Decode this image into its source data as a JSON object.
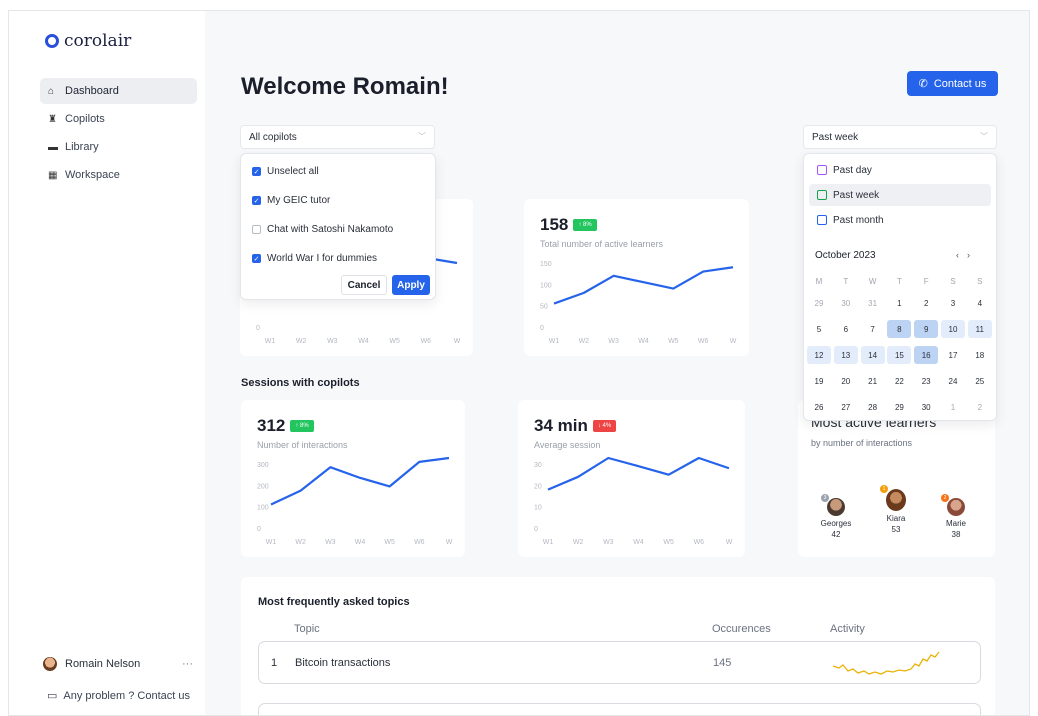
{
  "brand": {
    "name": "corolair",
    "accent": "#2563eb"
  },
  "sidebar": {
    "items": [
      {
        "label": "Dashboard",
        "icon": "home-icon",
        "active": true
      },
      {
        "label": "Copilots",
        "icon": "copilot-icon",
        "active": false
      },
      {
        "label": "Library",
        "icon": "folder-icon",
        "active": false
      },
      {
        "label": "Workspace",
        "icon": "building-icon",
        "active": false
      }
    ],
    "user": {
      "name": "Romain Nelson",
      "more": "···"
    },
    "help": "Any problem ? Contact us"
  },
  "header": {
    "title": "Welcome Romain!",
    "contact_label": "Contact us"
  },
  "filters": {
    "copilots_label": "All copilots",
    "period_label": "Past week"
  },
  "copilot_dropdown": {
    "options": [
      {
        "label": "Unselect all",
        "checked": true
      },
      {
        "label": "My GEIC tutor",
        "checked": true
      },
      {
        "label": "Chat with Satoshi Nakamoto",
        "checked": false
      },
      {
        "label": "World War I for dummies",
        "checked": true
      }
    ],
    "cancel": "Cancel",
    "apply": "Apply"
  },
  "period_dropdown": {
    "options": [
      {
        "label": "Past day",
        "color": "#a855f7",
        "selected": false
      },
      {
        "label": "Past week",
        "color": "#16a34a",
        "selected": true
      },
      {
        "label": "Past month",
        "color": "#2563eb",
        "selected": false
      }
    ],
    "month": "October 2023",
    "prev": "‹",
    "next": "›",
    "weekdays": [
      "M",
      "T",
      "W",
      "T",
      "F",
      "S",
      "S"
    ],
    "weeks": [
      [
        "29",
        "30",
        "31",
        "1",
        "2",
        "3",
        "4"
      ],
      [
        "5",
        "6",
        "7",
        "8",
        "9",
        "10",
        "11"
      ],
      [
        "12",
        "13",
        "14",
        "15",
        "16",
        "17",
        "18"
      ],
      [
        "19",
        "20",
        "21",
        "22",
        "23",
        "24",
        "25"
      ],
      [
        "26",
        "27",
        "28",
        "29",
        "30",
        "1",
        "2"
      ]
    ]
  },
  "sections": {
    "sessions": "Sessions with copilots"
  },
  "cards": {
    "learners": {
      "value": "158",
      "badge": "↑ 8%",
      "label": "Total number of active learners"
    },
    "interactions": {
      "value": "312",
      "badge": "↑ 8%",
      "label": "Number of interactions"
    },
    "session": {
      "value": "34 min",
      "badge": "↓ 4%",
      "label": "Average session"
    }
  },
  "chart_data": [
    {
      "type": "line",
      "id": "hidden-copilots",
      "categories": [
        "W1",
        "W2",
        "W3",
        "W4",
        "W5",
        "W6",
        "W"
      ],
      "yticks": [
        "0"
      ],
      "series": [
        {
          "values": [
            null,
            null,
            null,
            null,
            null,
            null,
            0.55
          ]
        }
      ]
    },
    {
      "type": "line",
      "id": "active-learners",
      "categories": [
        "W1",
        "W2",
        "W3",
        "W4",
        "W5",
        "W6",
        "W"
      ],
      "yticks": [
        "150",
        "100",
        "50",
        "0"
      ],
      "ylim": [
        0,
        150
      ],
      "series": [
        {
          "values": [
            55,
            80,
            120,
            105,
            90,
            130,
            140
          ]
        }
      ]
    },
    {
      "type": "line",
      "id": "interactions",
      "categories": [
        "W1",
        "W2",
        "W3",
        "W4",
        "W5",
        "W6",
        "W"
      ],
      "yticks": [
        "300",
        "200",
        "100",
        "0"
      ],
      "ylim": [
        0,
        300
      ],
      "series": [
        {
          "values": [
            110,
            175,
            285,
            235,
            195,
            310,
            345
          ]
        }
      ]
    },
    {
      "type": "line",
      "id": "session",
      "categories": [
        "W1",
        "W2",
        "W3",
        "W4",
        "W5",
        "W6",
        "W"
      ],
      "yticks": [
        "30",
        "20",
        "10",
        "0"
      ],
      "ylim": [
        0,
        30
      ],
      "series": [
        {
          "values": [
            18,
            24,
            35,
            29,
            25,
            33,
            28
          ]
        }
      ]
    }
  ],
  "most_active": {
    "title": "Most active learners",
    "subtitle": "by number of interactions",
    "learners": [
      {
        "name": "Georges",
        "count": "42",
        "rank": "3",
        "rank_color": "#9ca3af"
      },
      {
        "name": "Kiara",
        "count": "53",
        "rank": "1",
        "rank_color": "#f59e0b"
      },
      {
        "name": "Marie",
        "count": "38",
        "rank": "2",
        "rank_color": "#f97316"
      }
    ]
  },
  "topics": {
    "title": "Most frequently asked topics",
    "columns": [
      "Topic",
      "Occurences",
      "Activity"
    ],
    "rows": [
      {
        "rank": "1",
        "topic": "Bitcoin transactions",
        "occurrences": "145"
      }
    ]
  }
}
